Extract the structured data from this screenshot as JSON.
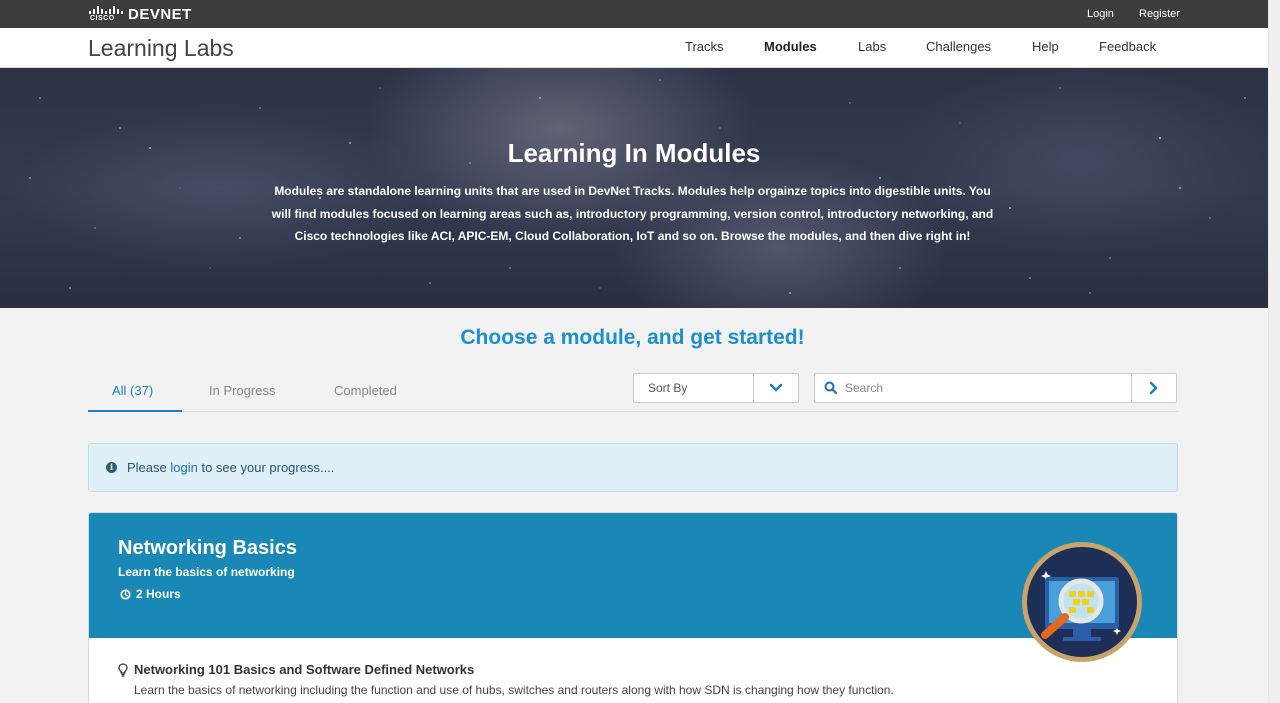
{
  "topbar": {
    "brand_cisco": "CISCO",
    "brand_devnet": "DEVNET",
    "login_label": "Login",
    "register_label": "Register"
  },
  "nav": {
    "site_title": "Learning Labs",
    "items": [
      {
        "label": "Tracks",
        "active": false
      },
      {
        "label": "Modules",
        "active": true
      },
      {
        "label": "Labs",
        "active": false
      },
      {
        "label": "Challenges",
        "active": false
      },
      {
        "label": "Help",
        "active": false
      },
      {
        "label": "Feedback",
        "active": false
      }
    ]
  },
  "hero": {
    "title": "Learning In Modules",
    "text": "Modules are standalone learning units that are used in DevNet Tracks. Modules help orgainze topics into digestible units. You will find modules focused on learning areas such as, introductory programming, version control, introductory networking, and Cisco technologies like ACI, APIC-EM, Cloud Collaboration, IoT and so on. Browse the modules, and then dive right in!"
  },
  "main": {
    "heading": "Choose a module, and get started!",
    "tabs": [
      {
        "label": "All (37)",
        "active": true
      },
      {
        "label": "In Progress",
        "active": false
      },
      {
        "label": "Completed",
        "active": false
      }
    ],
    "sort_label": "Sort By",
    "search_placeholder": "Search",
    "alert": {
      "prefix": "Please ",
      "link": "login",
      "suffix": " to see your progress...."
    }
  },
  "module": {
    "title": "Networking Basics",
    "subtitle": "Learn the basics of networking",
    "duration": "2 Hours",
    "lesson_title": "Networking 101 Basics and Software Defined Networks",
    "lesson_desc": "Learn the basics of networking including the function and use of hubs, switches and routers along with how SDN is changing how they function."
  },
  "colors": {
    "accent_blue": "#1d8fcf",
    "card_header": "#1a88b6",
    "topbar": "#3d3d3d",
    "alert_bg": "#dff0f8"
  },
  "icons": [
    "cisco-logo",
    "chevron-down-icon",
    "search-icon",
    "chevron-right-icon",
    "info-icon",
    "clock-icon",
    "lightbulb-icon",
    "module-badge-magnifier-icon"
  ]
}
